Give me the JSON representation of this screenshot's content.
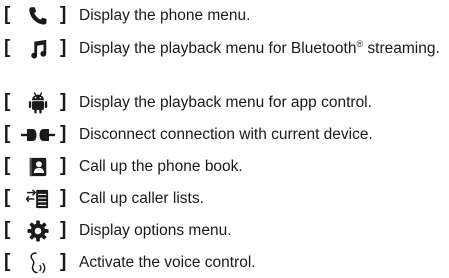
{
  "bracket_open": "[",
  "bracket_close": "]",
  "items": [
    {
      "icon": "phone-icon",
      "text": "Display the phone menu."
    },
    {
      "icon": "music-note-icon",
      "text_before": "Display the playback menu for Bluetooth",
      "text_sup": "®",
      "text_after": " streaming."
    },
    {
      "icon": "android-icon",
      "text": "Display the playback menu for app control."
    },
    {
      "icon": "disconnect-plug-icon",
      "text": "Disconnect connection with current device."
    },
    {
      "icon": "phonebook-icon",
      "text": "Call up the phone book."
    },
    {
      "icon": "caller-list-icon",
      "text": "Call up caller lists."
    },
    {
      "icon": "gear-icon",
      "text": "Display options menu."
    },
    {
      "icon": "voice-control-icon",
      "text": "Activate the voice control."
    }
  ],
  "colors": {
    "text": "#1a1a1a",
    "icon": "#1a1a1a"
  }
}
